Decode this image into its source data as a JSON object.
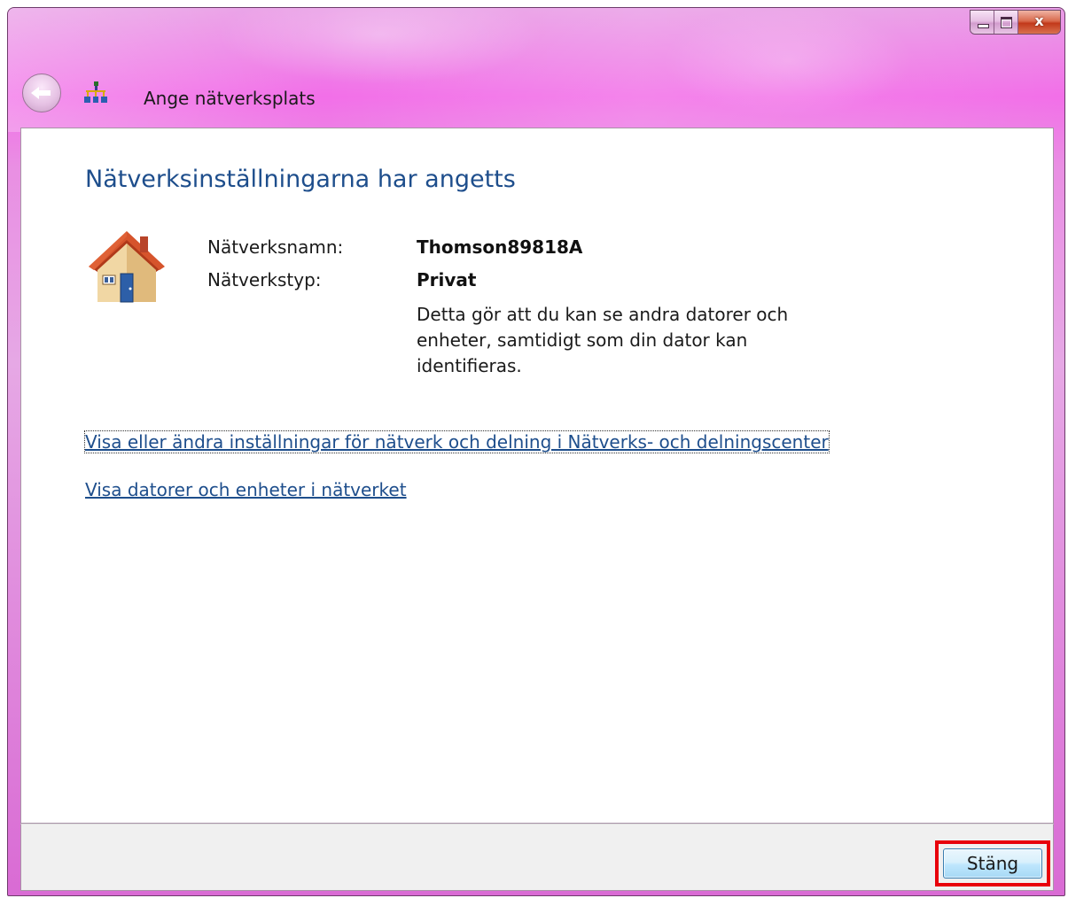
{
  "window": {
    "title": "Ange nätverksplats",
    "controls": {
      "minimize_icon": "minimize-icon",
      "maximize_icon": "maximize-icon",
      "close_glyph": "x"
    }
  },
  "content": {
    "heading": "Nätverksinställningarna har angetts",
    "icon": "home-network-icon",
    "network_name_label": "Nätverksnamn:",
    "network_name_value": "Thomson89818A",
    "network_type_label": "Nätverkstyp:",
    "network_type_value": "Privat",
    "network_type_description": "Detta gör att du kan se andra datorer och enheter, samtidigt som din dator kan identifieras.",
    "links": {
      "network_center": "Visa eller ändra inställningar för nätverk och delning i Nätverks- och delningscenter",
      "view_computers": "Visa datorer och enheter i nätverket"
    }
  },
  "footer": {
    "close_button_label": "Stäng",
    "highlight_color": "#e8000b"
  },
  "colors": {
    "heading_blue": "#1e4e8c",
    "title_bar_pink": "#f26fe8"
  }
}
